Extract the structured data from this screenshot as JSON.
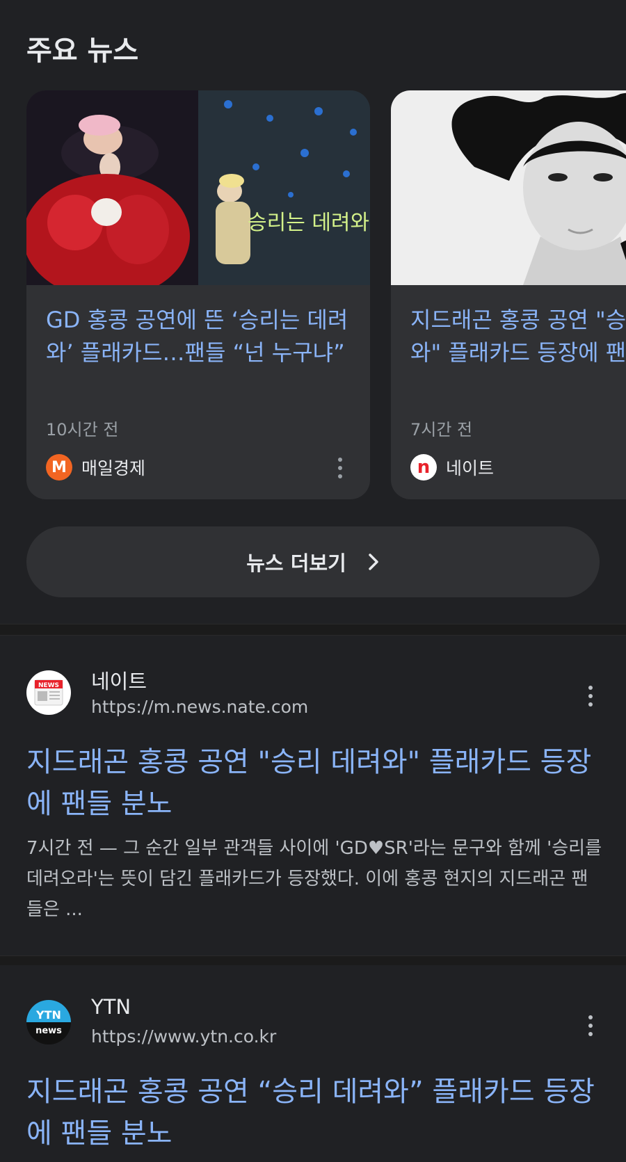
{
  "top_news": {
    "section_title": "주요 뉴스",
    "cards": [
      {
        "title": "GD 홍콩 공연에 뜬 ‘승리는 데려와’ 플래카드…팬들 “넌 누구냐”",
        "time": "10시간 전",
        "source": "매일경제",
        "source_logo_letter": "M",
        "image_text": "승리는 데려와",
        "icon": "more-vert-icon"
      },
      {
        "title": "지드래곤 홍콩 공연 \"승리 데려와\" 플래카드 등장에 팬들 분노",
        "time": "7시간 전",
        "source": "네이트",
        "source_logo_letter": "n",
        "icon": "more-vert-icon"
      }
    ],
    "more_button": "뉴스 더보기"
  },
  "results": [
    {
      "site_name": "네이트",
      "url": "https://m.news.nate.com",
      "favicon_text": "NEWS",
      "title": "지드래곤 홍콩 공연 \"승리 데려와\" 플래카드 등장에 팬들 분노",
      "snippet": "7시간 전 — 그 순간 일부 관객들 사이에 'GD♥SR'라는 문구와 함께 '승리를 데려오라'는 뜻이 담긴 플래카드가 등장했다. 이에 홍콩 현지의 지드래곤 팬들은 ..."
    },
    {
      "site_name": "YTN",
      "url": "https://www.ytn.co.kr",
      "favicon_text_top": "YTN",
      "favicon_text_bottom": "news",
      "title": "지드래곤 홍콩 공연 “승리 데려와” 플래카드 등장에 팬들 분노"
    }
  ],
  "colors": {
    "background": "#202124",
    "card": "#303134",
    "link": "#8ab4f8",
    "mk_logo": "#f26522",
    "nate_logo": "#e8222b",
    "ytn_logo": "#2aa8e0"
  }
}
